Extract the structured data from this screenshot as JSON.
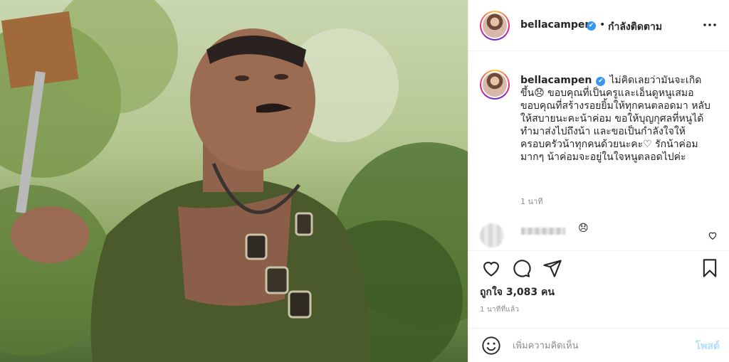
{
  "post": {
    "photo_alt": "photo",
    "username": "bellacampen",
    "verified_mark": "✔",
    "follow_separator": "•",
    "follow_status": "กำลังติดตาม"
  },
  "caption": {
    "username": "bellacampen",
    "text": "ไม่คิดเลยว่ามันจะเกิดขึ้น😞 ขอบคุณที่เป็นครูและเอ็นดูหนูเสมอ ขอบคุณที่สร้างรอยยิ้มให้ทุกคนตลอดมา หลับให้สบายนะคะน้าค่อม ขอให้บุญกุศลที่หนูได้ทำมาส่งไปถึงน้า และขอเป็นกำลังใจให้ครอบครัวน้าทุกคนด้วยนะคะ♡ รักน้าค่อมมากๆ น้าค่อมจะอยู่ในใจหนูตลอดไปค่ะ",
    "time": "1 นาที"
  },
  "comment": {
    "emoji": "😞"
  },
  "actions": {
    "like_icon": "heart-icon",
    "comment_icon": "comment-icon",
    "share_icon": "share-icon",
    "save_icon": "bookmark-icon"
  },
  "likes": "ถูกใจ 3,083 คน",
  "post_time": "1 นาทีที่แล้ว",
  "add_comment": {
    "placeholder": "เพิ่มความคิดเห็น",
    "post_label": "โพสต์"
  },
  "colors": {
    "accent": "#3897f0",
    "post_button_disabled": "#b2dffc",
    "muted_text": "#8e8e8e"
  }
}
